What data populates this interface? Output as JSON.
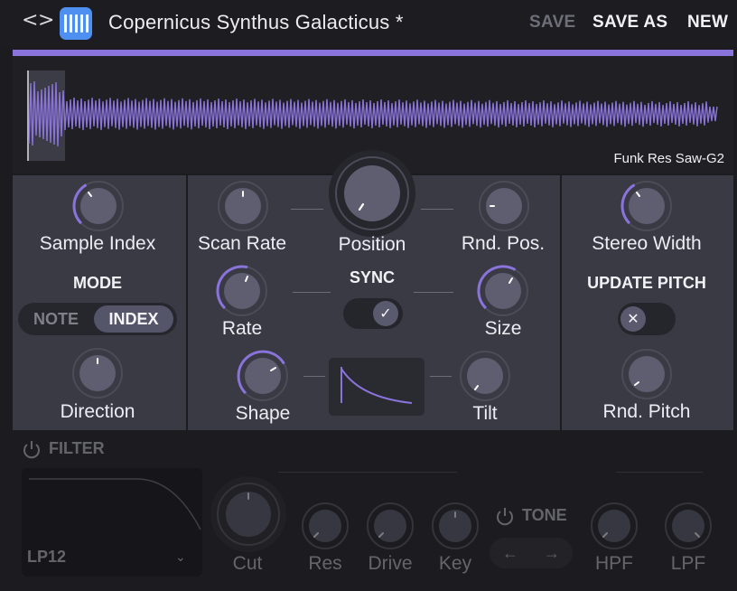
{
  "header": {
    "prev_arrow": "<",
    "next_arrow": ">",
    "preset_name": "Copernicus Synthus Galacticus *",
    "save_label": "SAVE",
    "save_as_label": "SAVE AS",
    "new_label": "NEW",
    "logo_icon": "piano-keys-icon",
    "accent_color": "#8a74dc"
  },
  "sample": {
    "name": "Funk Res Saw-G2"
  },
  "left_panel": {
    "sample_index_label": "Sample Index",
    "mode_title": "MODE",
    "mode_options": [
      "NOTE",
      "INDEX"
    ],
    "mode_selected": "INDEX",
    "direction_label": "Direction"
  },
  "center_panel": {
    "scan_rate_label": "Scan Rate",
    "position_label": "Position",
    "rnd_pos_label": "Rnd. Pos.",
    "sync_title": "SYNC",
    "sync_on": true,
    "rate_label": "Rate",
    "size_label": "Size",
    "shape_label": "Shape",
    "tilt_label": "Tilt"
  },
  "right_panel": {
    "stereo_width_label": "Stereo Width",
    "update_pitch_title": "UPDATE PITCH",
    "update_pitch_on": false,
    "rnd_pitch_label": "Rnd. Pitch"
  },
  "filter": {
    "title": "FILTER",
    "type": "LP12",
    "cut_label": "Cut",
    "res_label": "Res",
    "drive_label": "Drive",
    "key_label": "Key",
    "tone_title": "TONE",
    "hpf_label": "HPF",
    "lpf_label": "LPF"
  }
}
